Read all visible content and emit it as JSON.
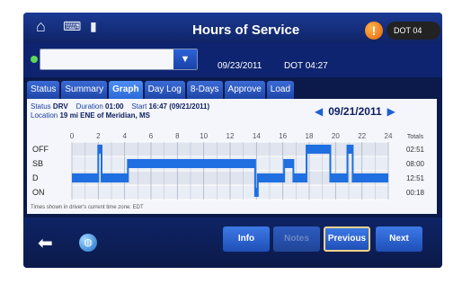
{
  "header": {
    "title": "Hours of Service",
    "warning_icon_glyph": "!",
    "dot_pill": "DOT 04"
  },
  "subheader": {
    "date": "09/23/2011",
    "dot_time": "DOT 04:27",
    "driver_select_value": ""
  },
  "tabs": [
    {
      "label": "Status",
      "active": false
    },
    {
      "label": "Summary",
      "active": false
    },
    {
      "label": "Graph",
      "active": true
    },
    {
      "label": "Day Log",
      "active": false
    },
    {
      "label": "8-Days",
      "active": false
    },
    {
      "label": "Approve",
      "active": false
    },
    {
      "label": "Load",
      "active": false
    }
  ],
  "graph_info": {
    "status_label": "Status",
    "status_value": "DRV",
    "duration_label": "Duration",
    "duration_value": "01:00",
    "start_label": "Start",
    "start_value": "16:47 (09/21/2011)",
    "location_label": "Location",
    "location_value": "19 mi ENE of Meridian, MS",
    "date": "09/21/2011",
    "prev_arrow": "◀",
    "next_arrow": "▶",
    "note": "Times shown in driver's current time zone: EDT"
  },
  "chart_data": {
    "type": "step",
    "x_ticks": [
      "0",
      "2",
      "4",
      "6",
      "8",
      "10",
      "12",
      "14",
      "16",
      "18",
      "20",
      "22",
      "24"
    ],
    "statuses": [
      "OFF",
      "SB",
      "D",
      "ON"
    ],
    "totals_header": "Totals",
    "totals": [
      "02:51",
      "08:00",
      "12:51",
      "00:18"
    ],
    "segments": [
      {
        "status": "D",
        "start": 0,
        "end": 2.0
      },
      {
        "status": "OFF",
        "start": 2.0,
        "end": 2.25
      },
      {
        "status": "D",
        "start": 2.25,
        "end": 4.25
      },
      {
        "status": "SB",
        "start": 4.25,
        "end": 13.9
      },
      {
        "status": "ON",
        "start": 13.9,
        "end": 14.1
      },
      {
        "status": "D",
        "start": 14.1,
        "end": 16.1
      },
      {
        "status": "SB",
        "start": 16.1,
        "end": 16.8
      },
      {
        "status": "D",
        "start": 16.8,
        "end": 17.8
      },
      {
        "status": "OFF",
        "start": 17.8,
        "end": 19.6
      },
      {
        "status": "D",
        "start": 19.6,
        "end": 20.9
      },
      {
        "status": "OFF",
        "start": 20.9,
        "end": 21.3
      },
      {
        "status": "D",
        "start": 21.3,
        "end": 24.0
      }
    ],
    "colors": {
      "line": "#1f6fe0",
      "grid": "#aab3c6",
      "band": "#dfe4ee"
    }
  },
  "footer": {
    "info_label": "Info",
    "notes_label": "Notes",
    "previous_label": "Previous",
    "next_label": "Next"
  }
}
